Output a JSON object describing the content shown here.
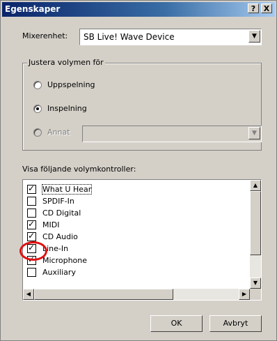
{
  "window": {
    "title": "Egenskaper"
  },
  "titlebar_buttons": {
    "help": "?",
    "close": "X"
  },
  "mixer": {
    "label": "Mixerenhet:",
    "value": "SB Live! Wave Device"
  },
  "adjust_group": {
    "legend": "Justera volymen för",
    "options": [
      {
        "label": "Uppspelning",
        "selected": false,
        "enabled": true
      },
      {
        "label": "Inspelning",
        "selected": true,
        "enabled": true
      },
      {
        "label": "Annat",
        "selected": false,
        "enabled": false
      }
    ],
    "other_combo_value": ""
  },
  "controls_label": "Visa följande volymkontroller:",
  "controls": [
    {
      "label": "What U Hear",
      "checked": true
    },
    {
      "label": "SPDIF-In",
      "checked": false
    },
    {
      "label": "CD Digital",
      "checked": false
    },
    {
      "label": "MIDI",
      "checked": true
    },
    {
      "label": "CD Audio",
      "checked": true
    },
    {
      "label": "Line-In",
      "checked": true
    },
    {
      "label": "Microphone",
      "checked": true
    },
    {
      "label": "Auxiliary",
      "checked": false
    }
  ],
  "buttons": {
    "ok": "OK",
    "cancel": "Avbryt"
  },
  "highlight": {
    "target": "Line-In",
    "color": "#e01010"
  }
}
